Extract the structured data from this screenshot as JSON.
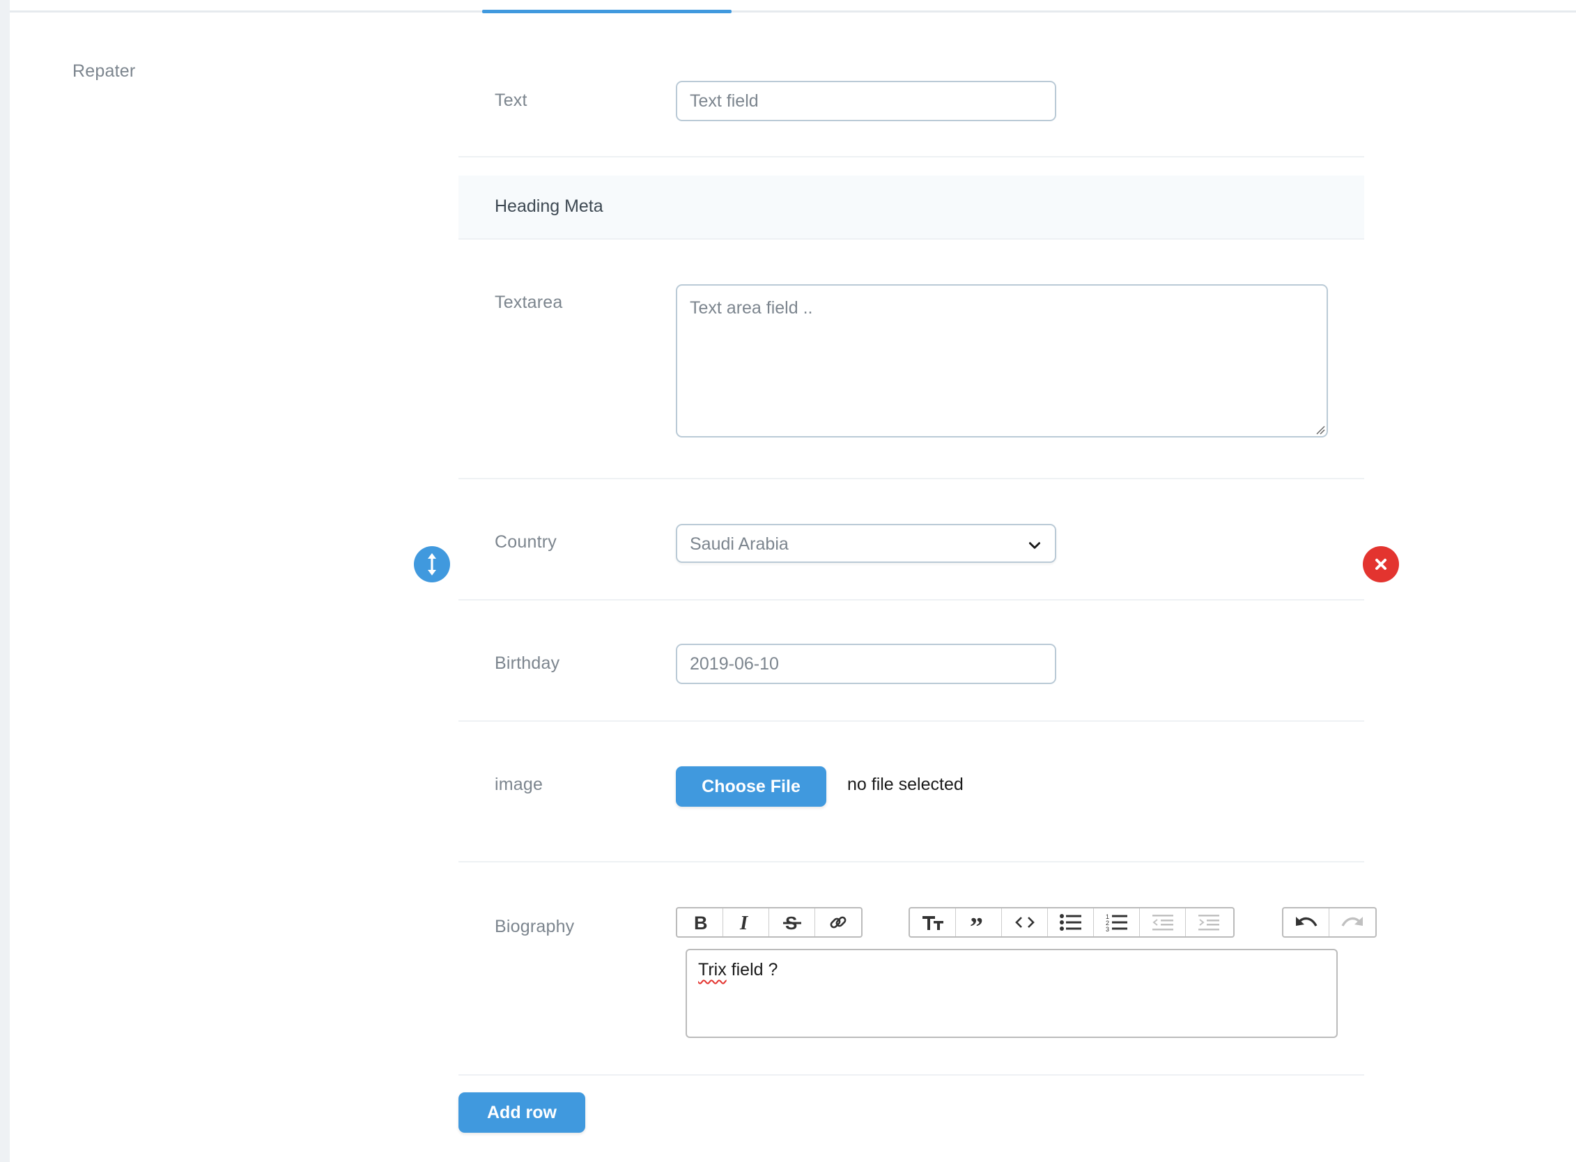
{
  "section": {
    "label": "Repater"
  },
  "fields": {
    "text": {
      "label": "Text",
      "placeholder": "Text field"
    },
    "heading": {
      "label": "Heading Meta"
    },
    "textarea": {
      "label": "Textarea",
      "placeholder": "Text area field .."
    },
    "country": {
      "label": "Country",
      "value": "Saudi Arabia"
    },
    "birthday": {
      "label": "Birthday",
      "value": "2019-06-10"
    },
    "image": {
      "label": "image",
      "button": "Choose File",
      "status": "no file selected"
    },
    "biography": {
      "label": "Biography",
      "content_word": "Trix",
      "content_rest": " field ?",
      "toolbar": [
        "bold-icon",
        "italic-icon",
        "strikethrough-icon",
        "link-icon",
        "heading-icon",
        "quote-icon",
        "code-icon",
        "bullet-list-icon",
        "number-list-icon",
        "outdent-icon",
        "indent-icon",
        "undo-icon",
        "redo-icon"
      ]
    }
  },
  "actions": {
    "add_row": "Add row"
  },
  "colors": {
    "primary": "#4099de",
    "danger": "#e3342f",
    "border": "#bacad6",
    "label": "#7c858e"
  }
}
